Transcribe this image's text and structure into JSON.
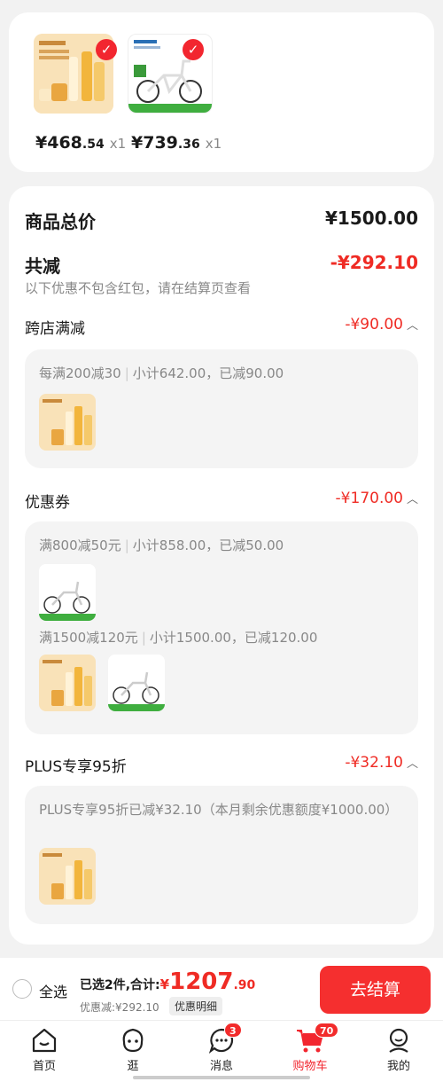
{
  "top_items": [
    {
      "currency": "¥",
      "price_int": "468",
      "price_dec": ".54",
      "qty": "x1",
      "image": "cosmetics-product-image"
    },
    {
      "currency": "¥",
      "price_int": "739",
      "price_dec": ".36",
      "qty": "x1",
      "image": "folding-bike-image"
    }
  ],
  "summary": {
    "total_label": "商品总价",
    "total_value": "¥1500.00",
    "discount_label": "共减",
    "discount_value": "-¥292.10",
    "discount_note": "以下优惠不包含红包，请在结算页查看"
  },
  "sections": {
    "cross_store": {
      "label": "跨店满减",
      "value": "-¥90.00",
      "rule": "每满200减30",
      "detail": "小计642.00，已减90.00"
    },
    "coupon": {
      "label": "优惠券",
      "value": "-¥170.00",
      "rule1": "满800减50元",
      "detail1": "小计858.00，已减50.00",
      "rule2": "满1500减120元",
      "detail2": "小计1500.00，已减120.00"
    },
    "plus": {
      "label": "PLUS专享95折",
      "value": "-¥32.10",
      "detail": "PLUS专享95折已减¥32.10（本月剩余优惠额度¥1000.00）"
    }
  },
  "footer": {
    "select_all": "全选",
    "selected_text": "已选2件,合计:",
    "currency": "¥",
    "total_int": "1207",
    "total_dec": ".90",
    "discount_text": "优惠减:¥292.10",
    "detail_btn": "优惠明细",
    "checkout_btn": "去结算"
  },
  "tabs": [
    {
      "label": "首页",
      "icon": "home-icon"
    },
    {
      "label": "逛",
      "icon": "browse-face-icon"
    },
    {
      "label": "消息",
      "icon": "message-icon",
      "badge": "3"
    },
    {
      "label": "购物车",
      "icon": "cart-icon",
      "badge": "70",
      "active": true
    },
    {
      "label": "我的",
      "icon": "profile-icon"
    }
  ],
  "colors": {
    "accent": "#ef2b24",
    "background": "#f2f2f2"
  }
}
